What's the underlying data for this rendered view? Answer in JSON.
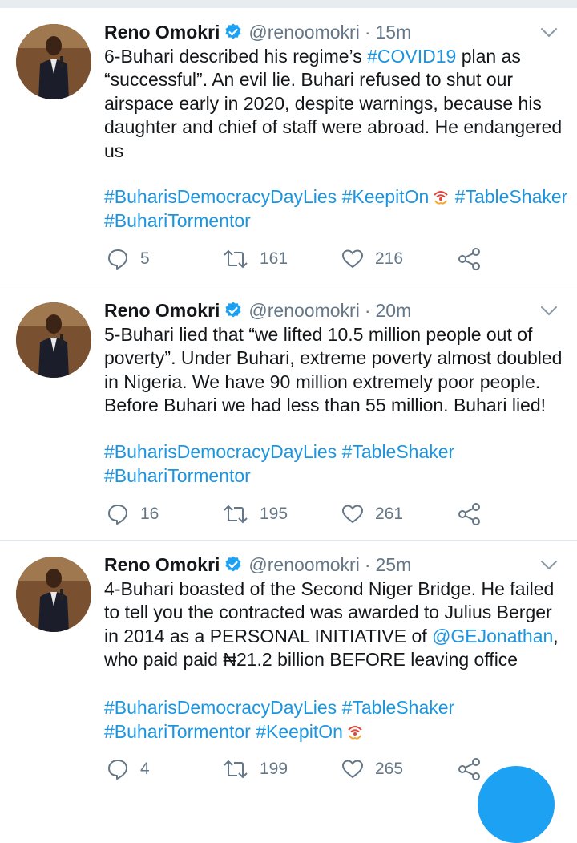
{
  "tweets": [
    {
      "name": "Reno Omokri",
      "handle": "@renoomokri",
      "sep": "·",
      "time": "15m",
      "text_a": "6-Buhari described his regime’s ",
      "text_link": "#COVID19",
      "text_b": " plan as “successful”. An evil lie. Buhari refused to shut our airspace early in 2020, despite warnings, because his daughter and chief of staff were abroad. He endangered us",
      "hashtags_line1": "#BuharisDemocracyDayLies #KeepitOn",
      "hashtags_line1b": "#TableShaker",
      "hashtags_line2": "#BuhariTormentor",
      "replies": "5",
      "retweets": "161",
      "likes": "216"
    },
    {
      "name": "Reno Omokri",
      "handle": "@renoomokri",
      "sep": "·",
      "time": "20m",
      "text": "5-Buhari lied that “we lifted 10.5 million people out of poverty”. Under Buhari, extreme poverty almost doubled in Nigeria. We have 90 million extremely poor people. Before Buhari we had less than 55 million. Buhari lied!",
      "hashtags_line1": "#BuharisDemocracyDayLies #TableShaker",
      "hashtags_line2": "#BuhariTormentor",
      "replies": "16",
      "retweets": "195",
      "likes": "261"
    },
    {
      "name": "Reno Omokri",
      "handle": "@renoomokri",
      "sep": "·",
      "time": "25m",
      "text_a": "4-Buhari boasted of the Second Niger Bridge. He failed to tell you the contracted was awarded to Julius Berger in 2014 as a PERSONAL INITIATIVE of ",
      "text_link": "@GEJonathan",
      "text_b": ", who paid paid ₦21.2 billion BEFORE leaving office",
      "hashtags_line1": "#BuharisDemocracyDayLies #TableShaker",
      "hashtags_line2": "#BuhariTormentor #KeepitOn",
      "replies": "4",
      "retweets": "199",
      "likes": "265"
    }
  ],
  "icons": {
    "verified": "verified-badge-icon",
    "menu": "chevron-down-icon",
    "reply": "reply-icon",
    "retweet": "retweet-icon",
    "like": "heart-icon",
    "share": "share-icon",
    "compose": "compose-fab"
  },
  "colors": {
    "link": "#1b95e0",
    "muted": "#657786",
    "verified": "#1da1f2",
    "fab": "#1da1f2"
  }
}
